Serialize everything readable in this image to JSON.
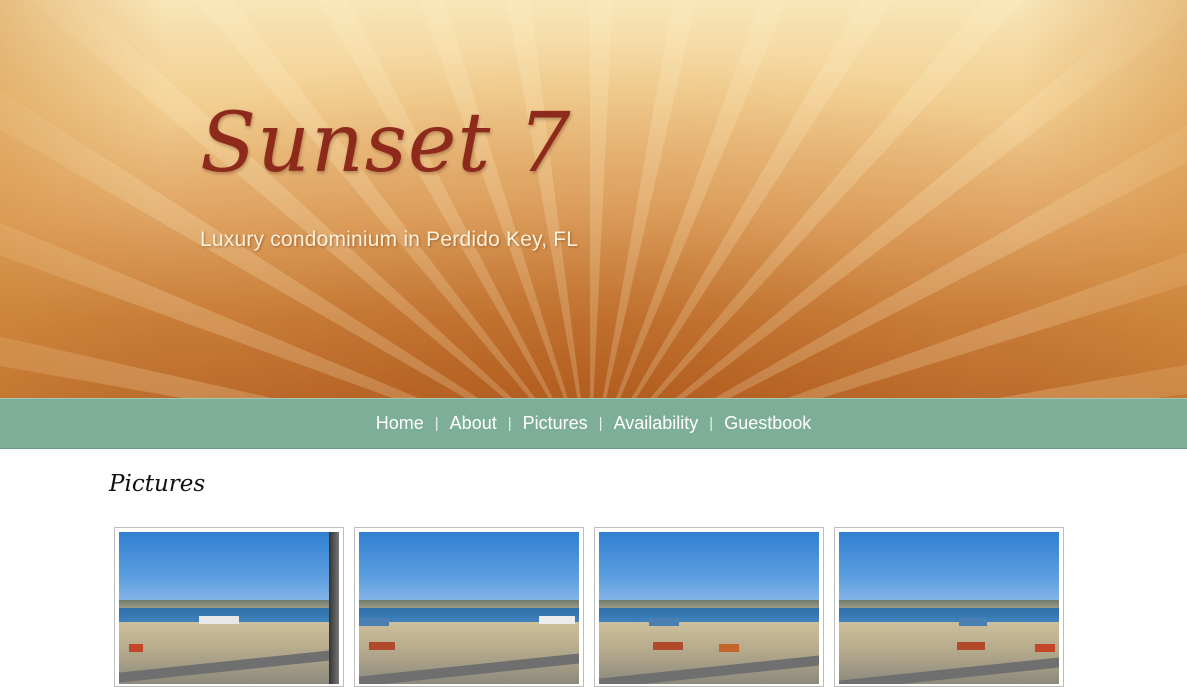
{
  "header": {
    "title": "Sunset 7",
    "tagline": "Luxury condominium in Perdido Key, FL"
  },
  "nav": {
    "items": [
      {
        "label": "Home"
      },
      {
        "label": "About"
      },
      {
        "label": "Pictures"
      },
      {
        "label": "Availability"
      },
      {
        "label": "Guestbook"
      }
    ],
    "separator": "|"
  },
  "main": {
    "title": "Pictures",
    "thumbnails": [
      {
        "alt": "view-1"
      },
      {
        "alt": "view-2"
      },
      {
        "alt": "view-3"
      },
      {
        "alt": "view-4"
      }
    ]
  },
  "colors": {
    "nav_bg": "#7dae97",
    "title_color": "#8e2a1c",
    "banner_bottom": "#b8682a"
  }
}
